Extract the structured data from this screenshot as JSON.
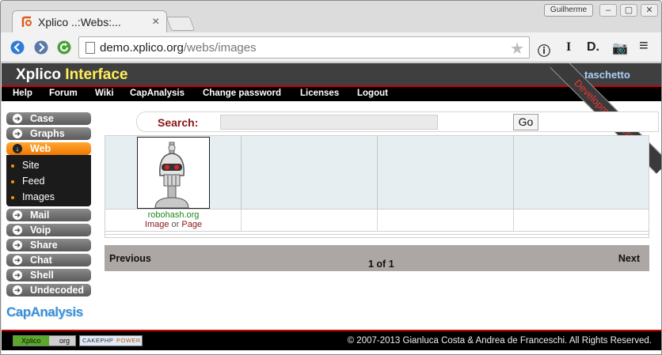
{
  "browser": {
    "tab_title": "Xplico ..:Webs:...",
    "tab_close": "×",
    "user_button": "Guilherme",
    "window_controls": [
      "‒",
      "▢",
      "✕"
    ],
    "url_host": "demo.xplico.org",
    "url_path": "/webs/images",
    "toolbar_ext": [
      "ⓘ",
      "I",
      "D.",
      "📷",
      "≡"
    ]
  },
  "header": {
    "brand_part1": "Xplico",
    "brand_part2": "Interface",
    "user": "taschetto",
    "ribbon": "Development Version"
  },
  "menu": [
    "Help",
    "Forum",
    "Wiki",
    "CapAnalysis",
    "Change password",
    "Licenses",
    "Logout"
  ],
  "sidebar": {
    "items_top": [
      "Case",
      "Graphs"
    ],
    "active": "Web",
    "sub": [
      "Site",
      "Feed",
      "Images"
    ],
    "items_bottom": [
      "Mail",
      "Voip",
      "Share",
      "Chat",
      "Shell",
      "Undecoded"
    ],
    "logo": "CapAnalysis"
  },
  "search": {
    "label": "Search:",
    "value": "",
    "go": "Go"
  },
  "results": [
    {
      "site": "robohash.org",
      "link_image": "Image",
      "or": "or",
      "link_page": "Page"
    }
  ],
  "pager": {
    "prev": "Previous",
    "next": "Next",
    "count": "1 of 1"
  },
  "footer": {
    "badge1_left": "Xplico",
    "badge1_right": "org",
    "badge2_left": "CAKEPHP",
    "badge2_right": "POWER",
    "copyright": "© 2007-2013 Gianluca Costa & Andrea de Franceschi. All Rights Reserved."
  },
  "colors": {
    "accent_red": "#cc0000",
    "brand_yellow": "#ffef5a",
    "active_orange": "#f07800",
    "site_green": "#1a8a1a"
  }
}
